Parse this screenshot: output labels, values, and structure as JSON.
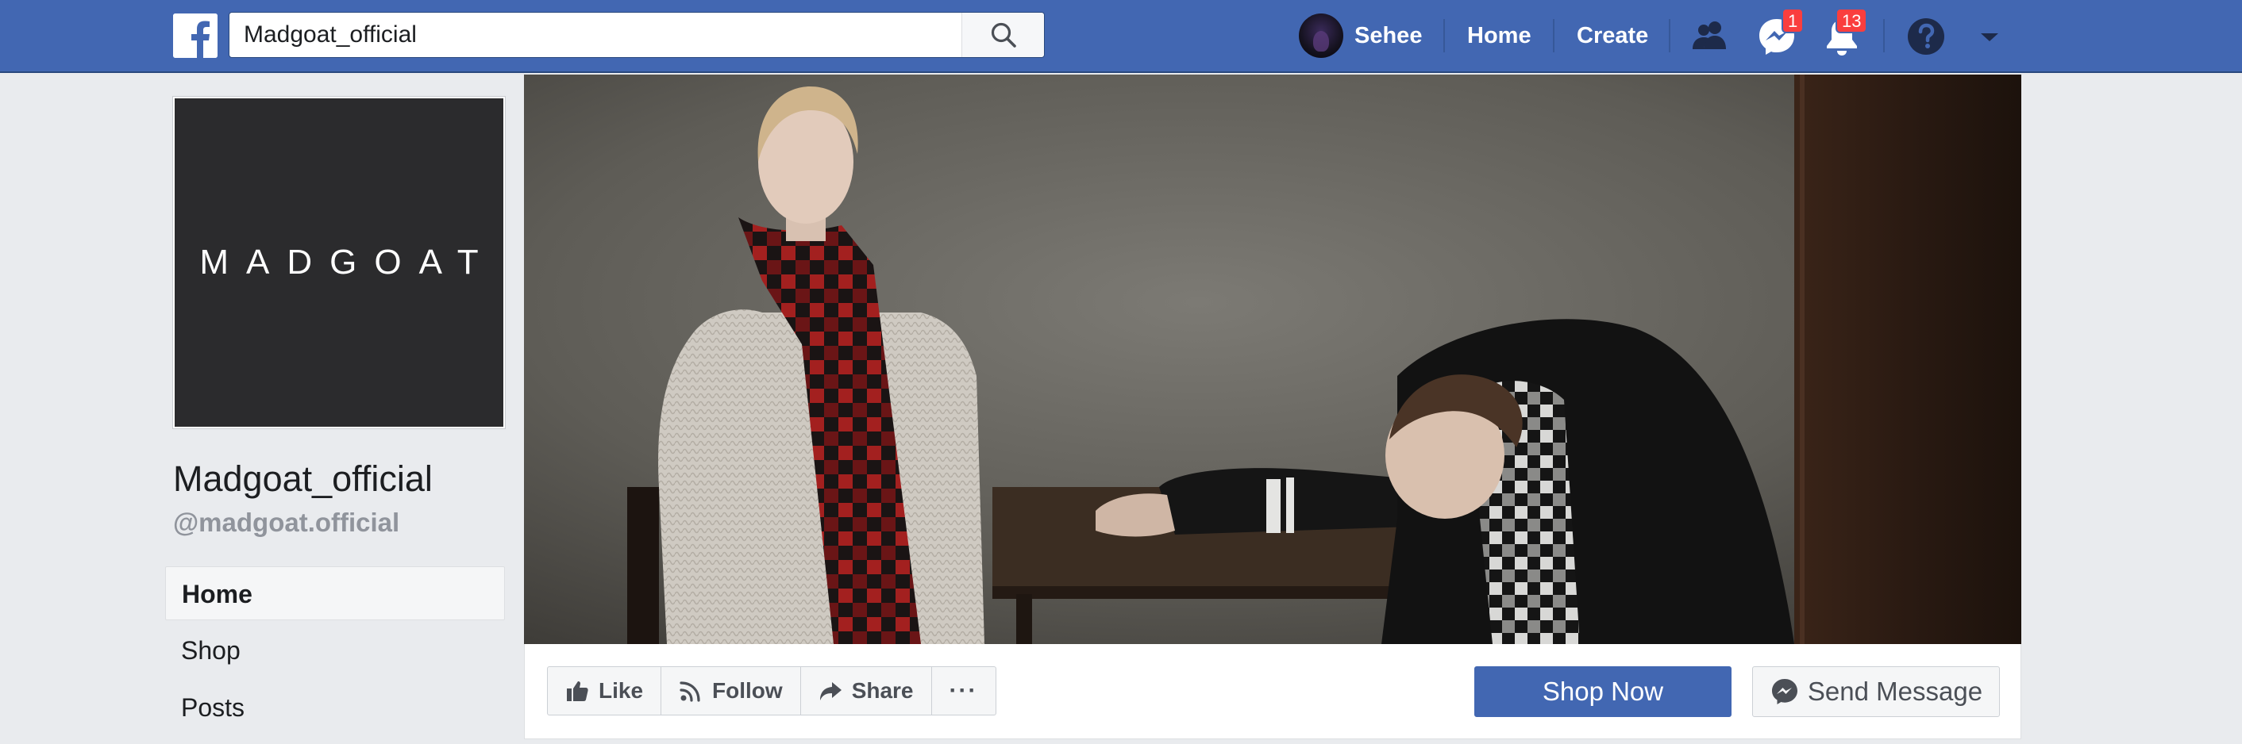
{
  "topbar": {
    "search": {
      "value": "Madgoat_official"
    },
    "user_name": "Sehee",
    "home_label": "Home",
    "create_label": "Create",
    "messages_badge": "1",
    "notifications_badge": "13",
    "icons": [
      "facebook-logo-icon",
      "search-icon",
      "friends-icon",
      "messenger-icon",
      "notifications-icon",
      "help-icon",
      "caret-down-icon"
    ],
    "colors": {
      "bar": "#4267b2",
      "badge": "#fa3e3e"
    }
  },
  "profile": {
    "logo_text": "MADGOAT",
    "name": "Madgoat_official",
    "handle": "@madgoat.official"
  },
  "sidebar": {
    "items": [
      {
        "label": "Home",
        "active": true
      },
      {
        "label": "Shop",
        "active": false
      },
      {
        "label": "Posts",
        "active": false
      }
    ]
  },
  "actions": {
    "like_label": "Like",
    "follow_label": "Follow",
    "share_label": "Share",
    "more_label": "···",
    "shop_now_label": "Shop Now",
    "send_message_label": "Send Message"
  }
}
